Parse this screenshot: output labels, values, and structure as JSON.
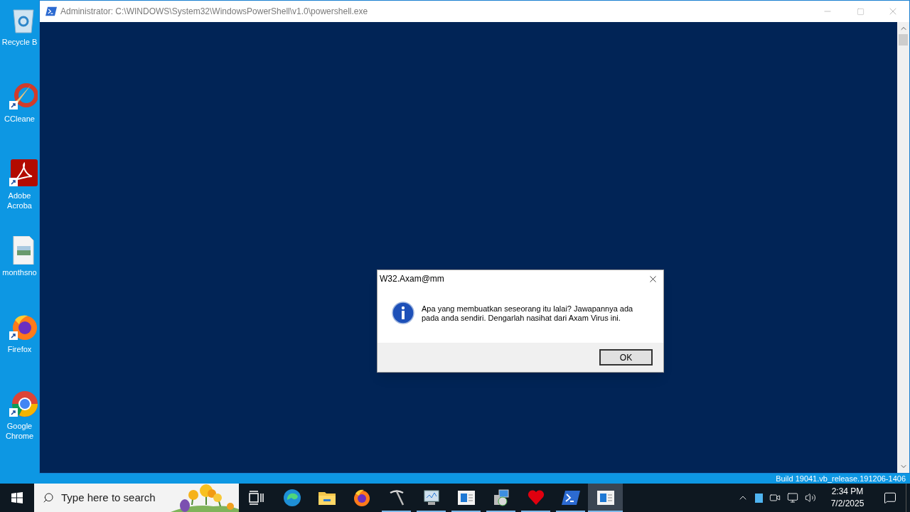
{
  "desktop_icons": [
    {
      "lines": [
        "Recycle B"
      ]
    },
    {
      "lines": [
        "CCleane"
      ]
    },
    {
      "lines": [
        "Adobe",
        "Acroba"
      ]
    },
    {
      "lines": [
        "monthsno"
      ]
    },
    {
      "lines": [
        "Firefox"
      ]
    },
    {
      "lines": [
        "Google",
        "Chrome"
      ]
    }
  ],
  "window": {
    "title": "Administrator: C:\\WINDOWS\\System32\\WindowsPowerShell\\v1.0\\powershell.exe"
  },
  "dialog": {
    "title": "W32.Axam@mm",
    "message": "Apa yang membuatkan seseorang itu lalai? Jawapannya ada pada anda sendiri. Dengarlah nasihat dari Axam Virus ini.",
    "button": "OK"
  },
  "build_text": "Build 19041.vb_release.191206-1406",
  "taskbar": {
    "search": {
      "placeholder": "Type here to search"
    },
    "apps": [
      {
        "running": false,
        "selected": false
      },
      {
        "running": false,
        "selected": false
      },
      {
        "running": false,
        "selected": false
      },
      {
        "running": false,
        "selected": false
      },
      {
        "running": true,
        "selected": false
      },
      {
        "running": true,
        "selected": false
      },
      {
        "running": true,
        "selected": false
      },
      {
        "running": true,
        "selected": false
      },
      {
        "running": true,
        "selected": false
      },
      {
        "running": true,
        "selected": false
      },
      {
        "running": true,
        "selected": true
      }
    ],
    "clock": {
      "time": "2:34 PM",
      "date": "7/2/2025"
    }
  }
}
